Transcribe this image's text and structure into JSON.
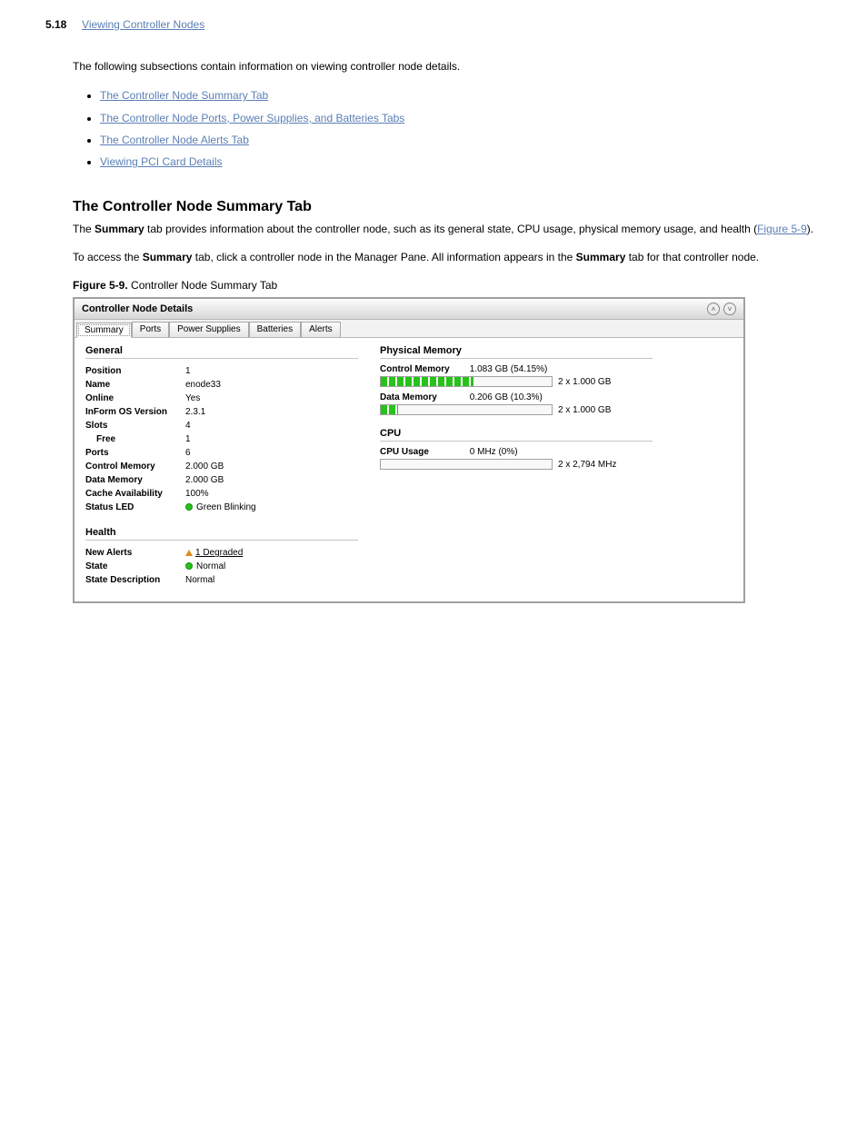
{
  "pageNumber": "5.18",
  "pageLink": "Viewing Controller Nodes",
  "intro": "The following subsections contain information on viewing controller node details.",
  "bullets": [
    "The Controller Node Summary Tab",
    "The Controller Node Ports, Power Supplies, and Batteries Tabs",
    "The Controller Node Alerts Tab",
    "Viewing PCI Card Details"
  ],
  "sectionTitle": "The Controller Node Summary Tab",
  "paragraph1_pre": "The ",
  "paragraph1_s1": "Summary",
  "paragraph1_mid": " tab provides information about the controller node, such as its general state, CPU usage, physical memory usage, and health (",
  "paragraph1_fig": "Figure 5-9",
  "paragraph1_post": ").",
  "paragraph2_pre": "To access the ",
  "paragraph2_s1": "Summary",
  "paragraph2_mid": " tab, click a controller node in the Manager Pane. All information appears in the ",
  "paragraph2_s2": "Summary",
  "paragraph2_end": " tab for that controller node.",
  "figure_label": "Figure 5-9.",
  "figure_title": "Controller Node Summary Tab",
  "shot": {
    "title": "Controller Node Details",
    "tabs": [
      "Summary",
      "Ports",
      "Power Supplies",
      "Batteries",
      "Alerts"
    ],
    "general": {
      "heading": "General",
      "rows": [
        {
          "k": "Position",
          "v": "1"
        },
        {
          "k": "Name",
          "v": "enode33"
        },
        {
          "k": "Online",
          "v": "Yes"
        },
        {
          "k": "InForm OS Version",
          "v": "2.3.1"
        },
        {
          "k": "Slots",
          "v": "4"
        },
        {
          "k": "Free",
          "v": "1",
          "indent": true
        },
        {
          "k": "Ports",
          "v": "6"
        },
        {
          "k": "Control Memory",
          "v": "2.000 GB"
        },
        {
          "k": "Data Memory",
          "v": "2.000 GB"
        },
        {
          "k": "Cache Availability",
          "v": "100%"
        },
        {
          "k": "Status LED",
          "v": "Green Blinking",
          "dot": true
        }
      ]
    },
    "health": {
      "heading": "Health",
      "newAlertsLabel": "New Alerts",
      "newAlertsValue": "1 Degraded",
      "stateLabel": "State",
      "stateValue": "Normal",
      "stateDescLabel": "State Description",
      "stateDescValue": "Normal"
    },
    "phys": {
      "heading": "Physical Memory",
      "controlLabel": "Control Memory",
      "controlValue": "1.083 GB (54.15%)",
      "controlRight": "2 x 1.000 GB",
      "controlPct": 54.15,
      "dataLabel": "Data Memory",
      "dataValue": "0.206 GB (10.3%)",
      "dataRight": "2 x 1.000 GB",
      "dataPct": 10.3
    },
    "cpu": {
      "heading": "CPU",
      "usageLabel": "CPU Usage",
      "usageValue": "0 MHz (0%)",
      "usageRight": "2 x 2,794 MHz",
      "pct": 0
    }
  }
}
